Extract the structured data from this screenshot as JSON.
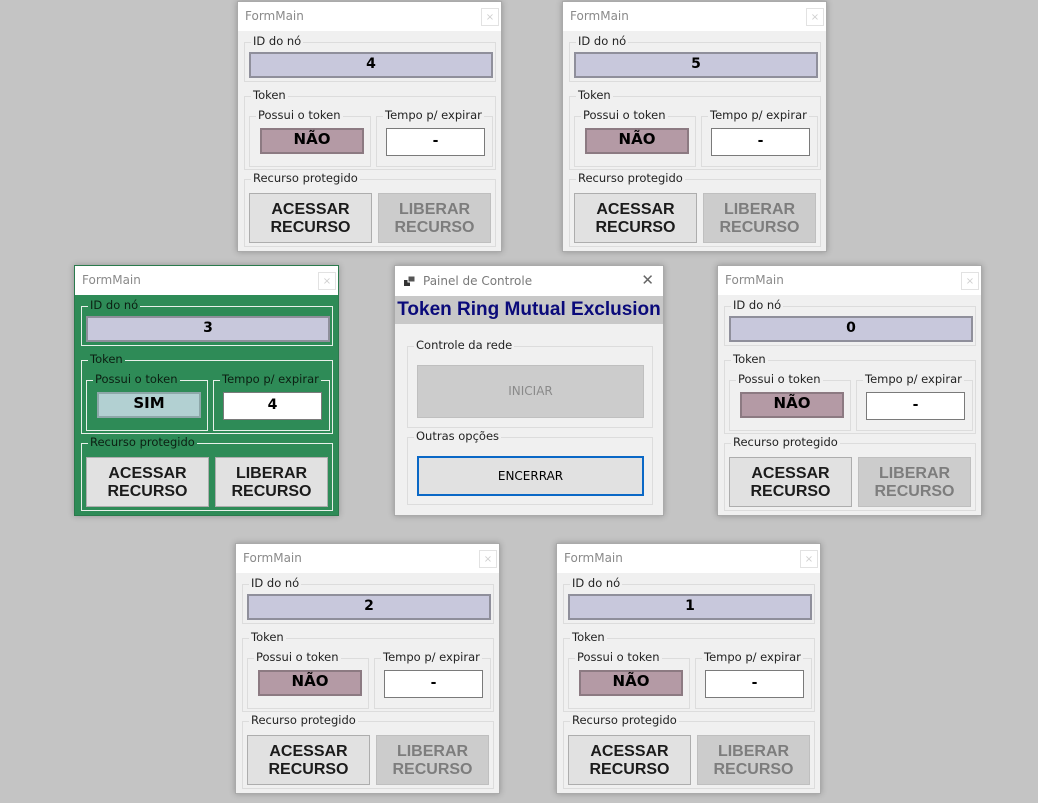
{
  "labels": {
    "window_title": "FormMain",
    "close_glyph": "×",
    "id_group": "ID do nó",
    "token_group": "Token",
    "has_token_group": "Possui o token",
    "expire_group": "Tempo p/ expirar",
    "resource_group": "Recurso protegido",
    "access_button": "ACESSAR RECURSO",
    "release_button": "LIBERAR RECURSO"
  },
  "nodes": [
    {
      "id": "4",
      "has_token": "NÃO",
      "expire": "-"
    },
    {
      "id": "5",
      "has_token": "NÃO",
      "expire": "-"
    },
    {
      "id": "3",
      "has_token": "SIM",
      "expire": "4",
      "active": true
    },
    {
      "id": "0",
      "has_token": "NÃO",
      "expire": "-"
    },
    {
      "id": "2",
      "has_token": "NÃO",
      "expire": "-"
    },
    {
      "id": "1",
      "has_token": "NÃO",
      "expire": "-"
    }
  ],
  "control_panel": {
    "title": "Painel de Controle",
    "close_glyph": "✕",
    "header": "Token Ring Mutual Exclusion",
    "network_group": "Controle da rede",
    "start_button": "INICIAR",
    "other_group": "Outras opções",
    "end_button": "ENCERRAR"
  },
  "colors": {
    "background": "#c4c4c4",
    "active_window": "#2e8b57",
    "id_box": "#c8c8dc",
    "no_token": "#b49aa5",
    "has_token": "#b2d0d2",
    "header_text": "#0a0a7a"
  }
}
